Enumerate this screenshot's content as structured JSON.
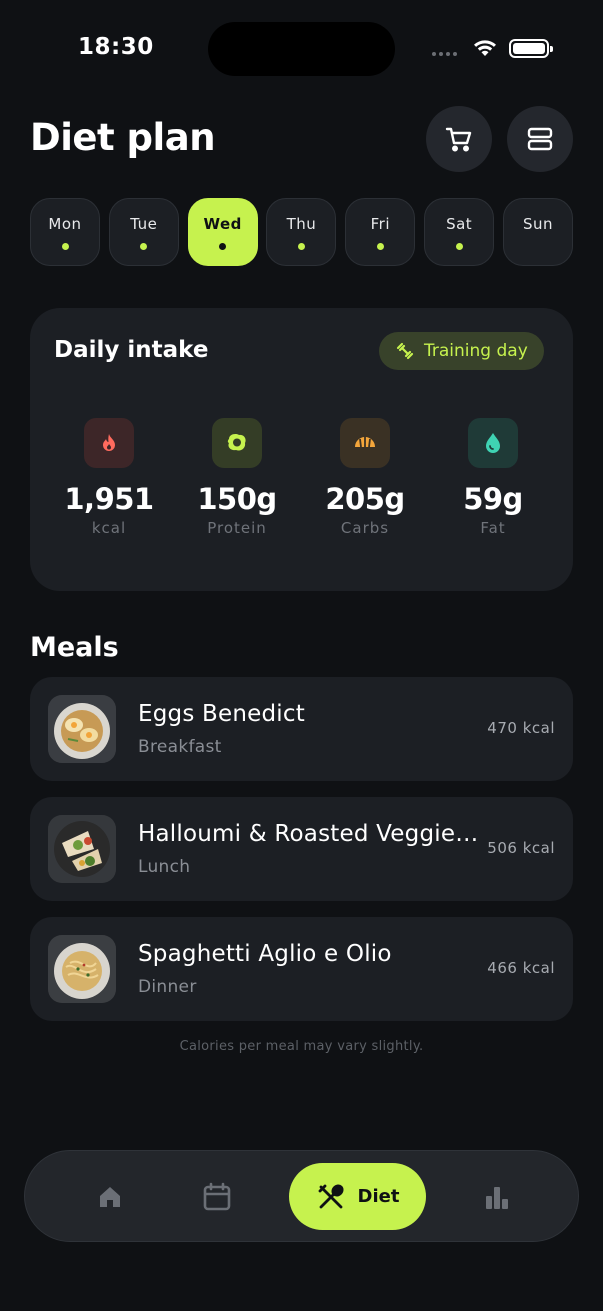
{
  "status_bar": {
    "time": "18:30"
  },
  "header": {
    "title": "Diet plan"
  },
  "days": [
    {
      "label": "Mon",
      "has_dot": true,
      "active": false
    },
    {
      "label": "Tue",
      "has_dot": true,
      "active": false
    },
    {
      "label": "Wed",
      "has_dot": true,
      "active": true
    },
    {
      "label": "Thu",
      "has_dot": true,
      "active": false
    },
    {
      "label": "Fri",
      "has_dot": true,
      "active": false
    },
    {
      "label": "Sat",
      "has_dot": true,
      "active": false
    },
    {
      "label": "Sun",
      "has_dot": false,
      "active": false
    }
  ],
  "intake": {
    "title": "Daily intake",
    "badge": "Training day",
    "macros": [
      {
        "value": "1,951",
        "label": "kcal",
        "icon": "flame-icon",
        "color": "#ff6b5e",
        "bg": "#3d2628"
      },
      {
        "value": "150g",
        "label": "Protein",
        "icon": "egg-icon",
        "color": "#c6f24e",
        "bg": "#343d26"
      },
      {
        "value": "205g",
        "label": "Carbs",
        "icon": "croissant-icon",
        "color": "#f4a63b",
        "bg": "#3a3124"
      },
      {
        "value": "59g",
        "label": "Fat",
        "icon": "drop-icon",
        "color": "#3fd3b3",
        "bg": "#1f3a37"
      }
    ]
  },
  "meals": {
    "title": "Meals",
    "items": [
      {
        "name": "Eggs Benedict",
        "type": "Breakfast",
        "kcal": "470 kcal"
      },
      {
        "name": "Halloumi & Roasted Veggie Wrap",
        "type": "Lunch",
        "kcal": "506 kcal"
      },
      {
        "name": "Spaghetti Aglio e Olio",
        "type": "Dinner",
        "kcal": "466 kcal"
      }
    ],
    "footnote": "Calories per meal may vary slightly."
  },
  "nav": {
    "items": [
      "home-icon",
      "calendar-icon",
      "diet-icon",
      "stats-icon"
    ],
    "active_label": "Diet"
  },
  "colors": {
    "accent": "#c6f24e",
    "background": "#0f1114",
    "card": "#1c1f24"
  }
}
